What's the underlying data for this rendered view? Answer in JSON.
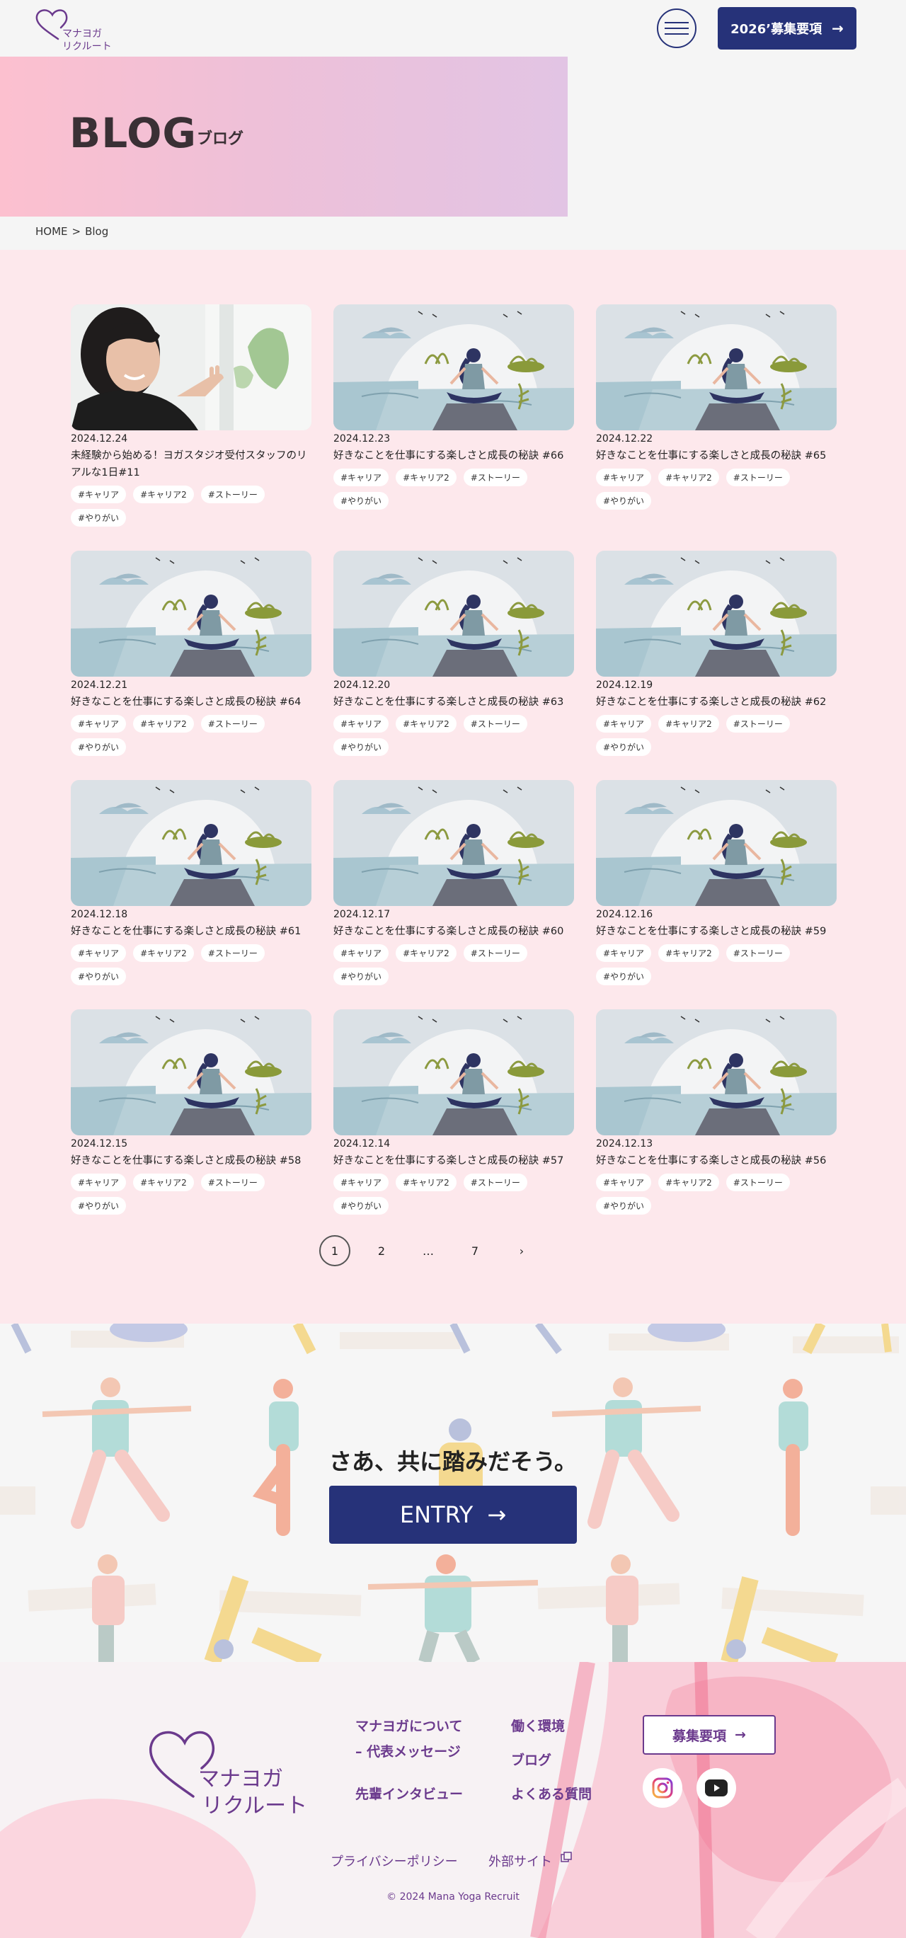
{
  "header": {
    "logo_line1": "マナヨガ",
    "logo_line2": "リクルート",
    "menu_label": "",
    "recruit_button_label": "2026ʼ募集要項",
    "recruit_button_arrow": "→"
  },
  "hero": {
    "title": "BLOG",
    "subtitle": "ブログ"
  },
  "breadcrumb": {
    "home": "HOME",
    "separator": ">",
    "current": "Blog"
  },
  "posts": [
    {
      "date": "2024.12.24",
      "title": "未経験から始める！ヨガスタジオ受付スタッフのリアルな1日#11",
      "tags": [
        "#キャリア",
        "#キャリア2",
        "#ストーリー",
        "#やりがい"
      ],
      "thumb": "person-photo"
    },
    {
      "date": "2024.12.23",
      "title": "好きなことを仕事にする楽しさと成長の秘訣 #66",
      "tags": [
        "#キャリア",
        "#キャリア2",
        "#ストーリー",
        "#やりがい"
      ],
      "thumb": "yoga-illustration"
    },
    {
      "date": "2024.12.22",
      "title": "好きなことを仕事にする楽しさと成長の秘訣 #65",
      "tags": [
        "#キャリア",
        "#キャリア2",
        "#ストーリー",
        "#やりがい"
      ],
      "thumb": "yoga-illustration"
    },
    {
      "date": "2024.12.21",
      "title": "好きなことを仕事にする楽しさと成長の秘訣 #64",
      "tags": [
        "#キャリア",
        "#キャリア2",
        "#ストーリー",
        "#やりがい"
      ],
      "thumb": "yoga-illustration"
    },
    {
      "date": "2024.12.20",
      "title": "好きなことを仕事にする楽しさと成長の秘訣 #63",
      "tags": [
        "#キャリア",
        "#キャリア2",
        "#ストーリー",
        "#やりがい"
      ],
      "thumb": "yoga-illustration"
    },
    {
      "date": "2024.12.19",
      "title": "好きなことを仕事にする楽しさと成長の秘訣 #62",
      "tags": [
        "#キャリア",
        "#キャリア2",
        "#ストーリー",
        "#やりがい"
      ],
      "thumb": "yoga-illustration"
    },
    {
      "date": "2024.12.18",
      "title": "好きなことを仕事にする楽しさと成長の秘訣 #61",
      "tags": [
        "#キャリア",
        "#キャリア2",
        "#ストーリー",
        "#やりがい"
      ],
      "thumb": "yoga-illustration"
    },
    {
      "date": "2024.12.17",
      "title": "好きなことを仕事にする楽しさと成長の秘訣 #60",
      "tags": [
        "#キャリア",
        "#キャリア2",
        "#ストーリー",
        "#やりがい"
      ],
      "thumb": "yoga-illustration"
    },
    {
      "date": "2024.12.16",
      "title": "好きなことを仕事にする楽しさと成長の秘訣 #59",
      "tags": [
        "#キャリア",
        "#キャリア2",
        "#ストーリー",
        "#やりがい"
      ],
      "thumb": "yoga-illustration"
    },
    {
      "date": "2024.12.15",
      "title": "好きなことを仕事にする楽しさと成長の秘訣 #58",
      "tags": [
        "#キャリア",
        "#キャリア2",
        "#ストーリー",
        "#やりがい"
      ],
      "thumb": "yoga-illustration"
    },
    {
      "date": "2024.12.14",
      "title": "好きなことを仕事にする楽しさと成長の秘訣 #57",
      "tags": [
        "#キャリア",
        "#キャリア2",
        "#ストーリー",
        "#やりがい"
      ],
      "thumb": "yoga-illustration"
    },
    {
      "date": "2024.12.13",
      "title": "好きなことを仕事にする楽しさと成長の秘訣 #56",
      "tags": [
        "#キャリア",
        "#キャリア2",
        "#ストーリー",
        "#やりがい"
      ],
      "thumb": "yoga-illustration"
    }
  ],
  "pagination": {
    "pages": [
      "1",
      "2",
      "…",
      "7"
    ],
    "current": "1",
    "next_icon": "chevron-right-icon",
    "next_label": "›"
  },
  "entry": {
    "heading": "さあ、共に踏みだそう。",
    "button_label": "ENTRY",
    "button_arrow": "→"
  },
  "footer": {
    "logo_line1": "マナヨガ",
    "logo_line2": "リクルート",
    "links": {
      "about_line1": "マナヨガについて",
      "about_line2": "– 代表メッセージ",
      "interview": "先輩インタビュー",
      "environment": "働く環境",
      "blog": "ブログ",
      "faq": "よくある質問"
    },
    "recruit_button_label": "募集要項",
    "recruit_button_arrow": "→",
    "social": [
      "instagram-icon",
      "youtube-icon"
    ],
    "privacy": "プライバシーポリシー",
    "external": "外部サイト",
    "copyright": "© 2024 Mana Yoga Recruit"
  },
  "colors": {
    "navy": "#263279",
    "purple": "#6b3a8d",
    "blog_bg": "#fde8ec",
    "hero_start": "#fcc0cf",
    "hero_end": "#e2c4e4"
  }
}
